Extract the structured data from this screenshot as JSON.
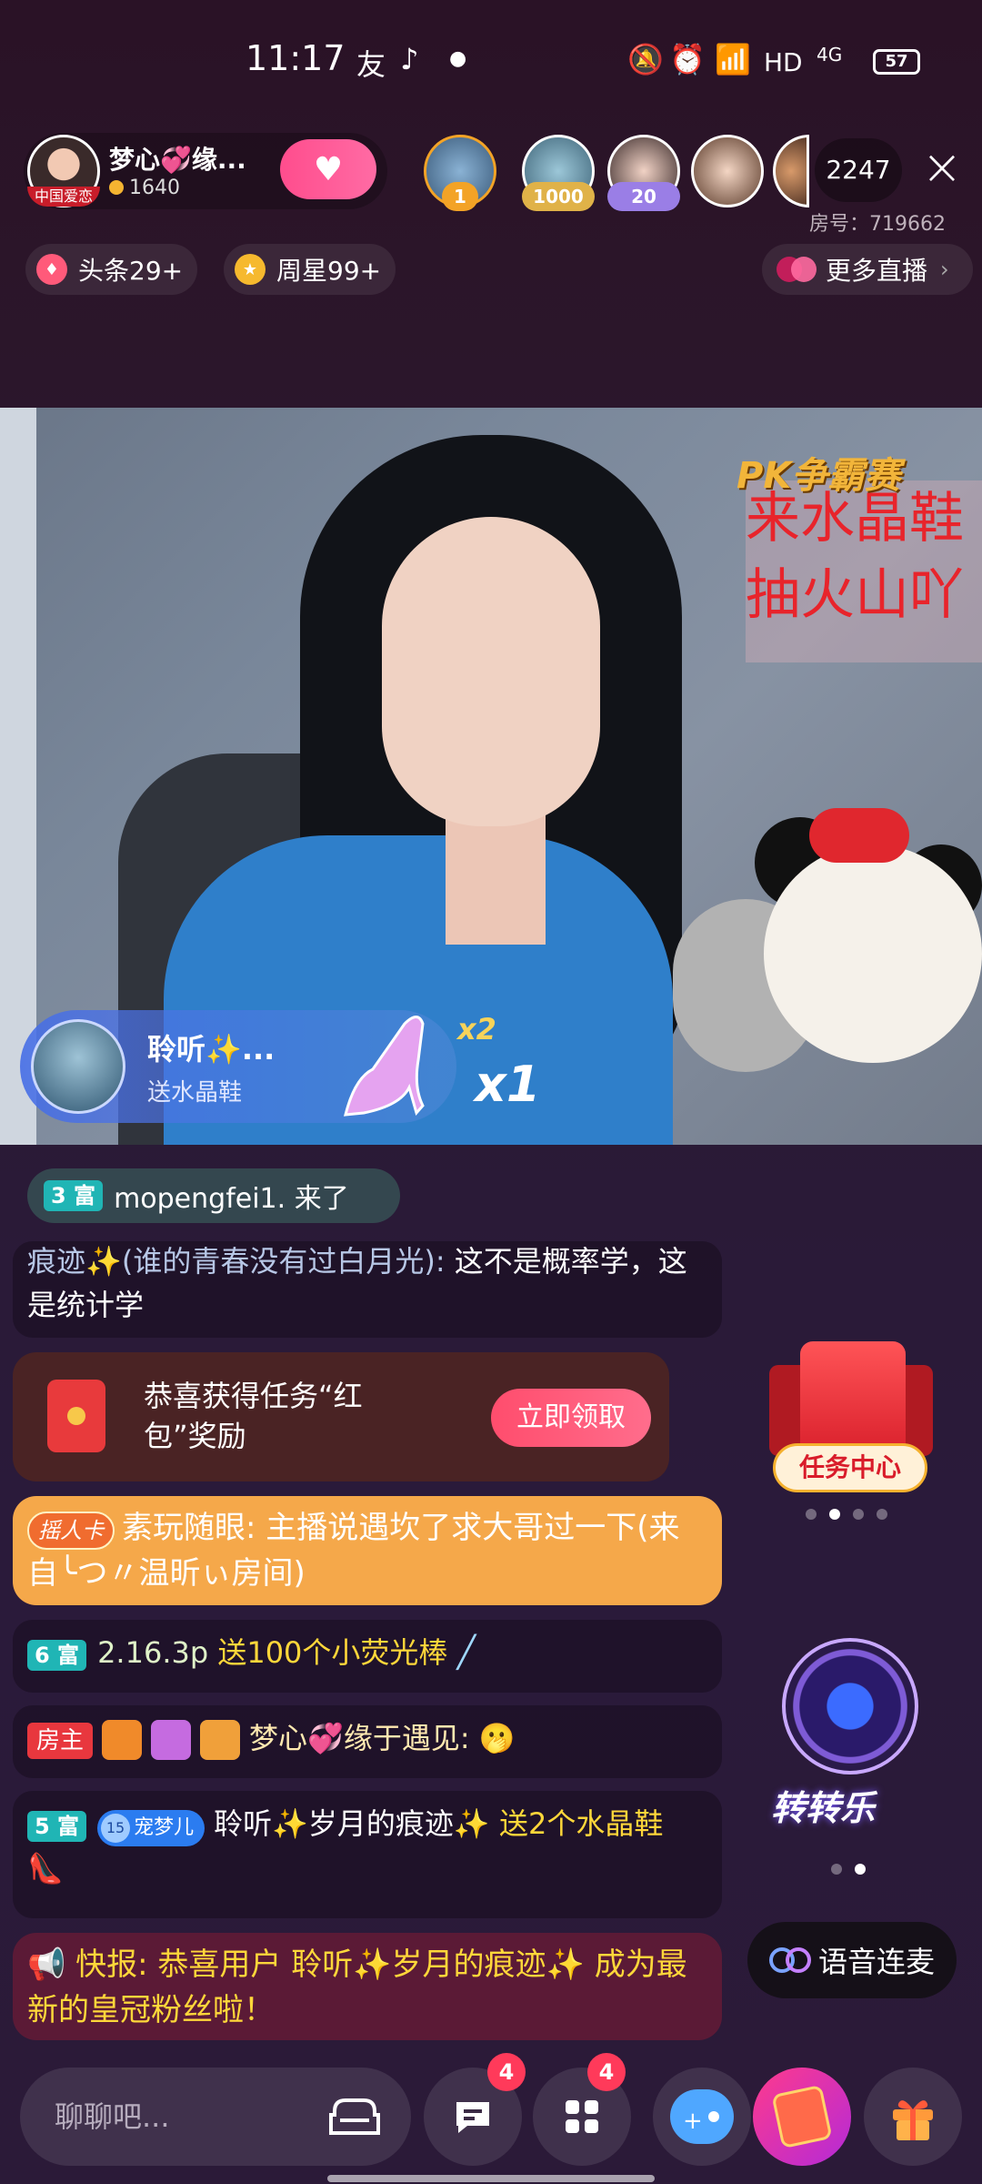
{
  "status_bar": {
    "time": "11:17",
    "network": "HD",
    "signal": "4G",
    "battery": "57"
  },
  "host": {
    "name": "梦心💞缘...",
    "likes": "1640",
    "avatar_tag": "中国爱恋",
    "follow_icon": "heart-plus-icon"
  },
  "viewers": [
    {
      "badge": "1",
      "badge_color": "#f3a326"
    },
    {
      "badge": "1000",
      "badge_color": "#e0b248"
    },
    {
      "badge": "20",
      "badge_color": "#9a7ee6"
    },
    {
      "badge": "",
      "badge_color": ""
    },
    {
      "badge": "",
      "badge_color": ""
    }
  ],
  "viewer_count": "2247",
  "room_no": "房号：719662",
  "chips": {
    "headline": "头条29+",
    "weekstar": "周星99+",
    "more_live": "更多直播"
  },
  "video": {
    "pk_title": "PK争霸赛",
    "sign_line1": "来水晶鞋",
    "sign_line2": "抽火山吖"
  },
  "gift_banner": {
    "sender": "聆听✨...",
    "action": "送水晶鞋",
    "combo_small": "x2",
    "combo_big": "x1"
  },
  "chat": {
    "entry": {
      "level": "3 富",
      "text": "mopengfei1. 来了"
    },
    "faded": {
      "nick": "痕迹✨(谁的青春没有过白月光):",
      "text": " 这不是概率学，这是统计学"
    },
    "task": {
      "text": "恭喜获得任务“红包”奖励",
      "button": "立即领取"
    },
    "gold": {
      "tag": "摇人卡",
      "text": "素玩随眼: 主播说遇坎了求大哥过一下(来自╰つ〃温昕ぃ房间)"
    },
    "gift1": {
      "level": "6 富",
      "nick": "2.16.3p",
      "text": "送100个小荧光棒"
    },
    "host_msg": {
      "badge": "房主",
      "nick": "梦心💞缘于遇见:",
      "emoji": "🫢"
    },
    "gift2": {
      "level": "5 富",
      "pet": "宠梦儿",
      "nick": "聆听✨岁月的痕迹✨",
      "text": "送2个水晶鞋"
    },
    "flash": {
      "text": "快报: 恭喜用户 聆听✨岁月的痕迹✨ 成为最新的皇冠粉丝啦！"
    }
  },
  "side": {
    "task_center": "任务中心",
    "spin": "转转乐",
    "voice": "语音连麦"
  },
  "bottom": {
    "input_placeholder": "聊聊吧...",
    "msg_badge": "4",
    "apps_badge": "4"
  }
}
